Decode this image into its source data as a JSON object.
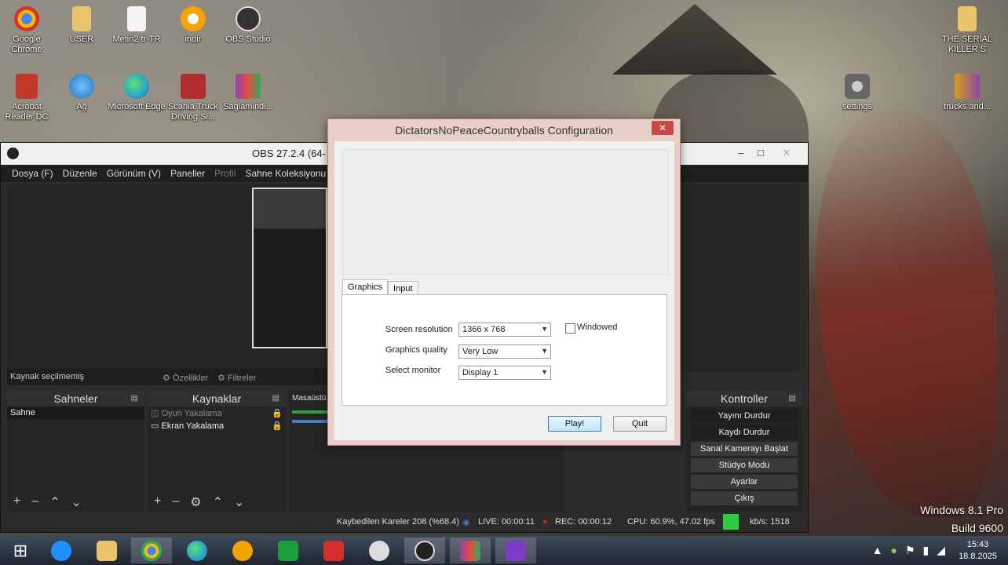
{
  "desktop": {
    "icons": [
      {
        "label": "Google Chrome",
        "icon": "chrome-icon",
        "color": "#d93025"
      },
      {
        "label": "USER",
        "icon": "folder-icon",
        "color": "#e9c46a"
      },
      {
        "label": "Metin2 tr-TR",
        "icon": "shortcut-icon",
        "color": "#f0f0f0"
      },
      {
        "label": "indir",
        "icon": "download-app-icon",
        "color": "#f4a300"
      },
      {
        "label": "OBS Studio",
        "icon": "obs-icon",
        "color": "#333333"
      },
      {
        "label": "Acrobat Reader DC",
        "icon": "acrobat-icon",
        "color": "#c0392b"
      },
      {
        "label": "Ağ",
        "icon": "network-icon",
        "color": "#3a8fd6"
      },
      {
        "label": "Microsoft Edge",
        "icon": "edge-icon",
        "color": "#2aa3c7"
      },
      {
        "label": "Scania.Truck Driving Si...",
        "icon": "game-icon",
        "color": "#b03030"
      },
      {
        "label": "Saglamindi...",
        "icon": "winrar-icon",
        "color": "#8e44ad"
      },
      {
        "label": "THE SERIAL KILLER S",
        "icon": "folder-icon",
        "color": "#e9c46a"
      },
      {
        "label": "settings",
        "icon": "settings-icon",
        "color": "#777777"
      },
      {
        "label": "trucks and...",
        "icon": "archive-icon",
        "color": "#d4a017"
      }
    ]
  },
  "obs": {
    "title": "OBS 27.2.4 (64-",
    "menu": [
      "Dosya (F)",
      "Düzenle",
      "Görünüm (V)",
      "Paneller",
      "Profil",
      "Sahne Koleksiyonu"
    ],
    "source_bar": {
      "status": "Kaynak seçilmemiş",
      "properties": "Özellikler",
      "filters": "Filtreler"
    },
    "scenes": {
      "title": "Sahneler",
      "items": [
        "Sahne"
      ]
    },
    "sources": {
      "title": "Kaynaklar",
      "items": [
        "Oyun Yakalama",
        "Ekran Yakalama"
      ]
    },
    "mixer": {
      "label": "Masaüstü S"
    },
    "controls": {
      "title": "Kontroller",
      "buttons": [
        "Yayını Durdur",
        "Kaydı Durdur",
        "Sanal Kamerayı Başlat",
        "Stüdyo Modu",
        "Ayarlar",
        "Çıkış"
      ]
    },
    "status": {
      "dropped": "Kaybedilen Kareler 208 (%68.4)",
      "live": "LIVE: 00:00:11",
      "rec": "REC: 00:00:12",
      "cpu": "CPU: 60.9%, 47.02 fps",
      "kbps": "kb/s: 1518"
    }
  },
  "dialog": {
    "title": "DictatorsNoPeaceCountryballs Configuration",
    "tabs": [
      "Graphics",
      "Input"
    ],
    "active_tab": "Graphics",
    "fields": {
      "resolution_label": "Screen resolution",
      "resolution_value": "1366 x 768",
      "quality_label": "Graphics quality",
      "quality_value": "Very Low",
      "monitor_label": "Select monitor",
      "monitor_value": "Display 1",
      "windowed_label": "Windowed",
      "windowed_checked": false
    },
    "buttons": {
      "play": "Play!",
      "quit": "Quit"
    }
  },
  "watermark": {
    "line1": "Windows 8.1 Pro",
    "line2": "Build 9600"
  },
  "clock": {
    "time": "15:43",
    "date": "18.8.2025"
  }
}
